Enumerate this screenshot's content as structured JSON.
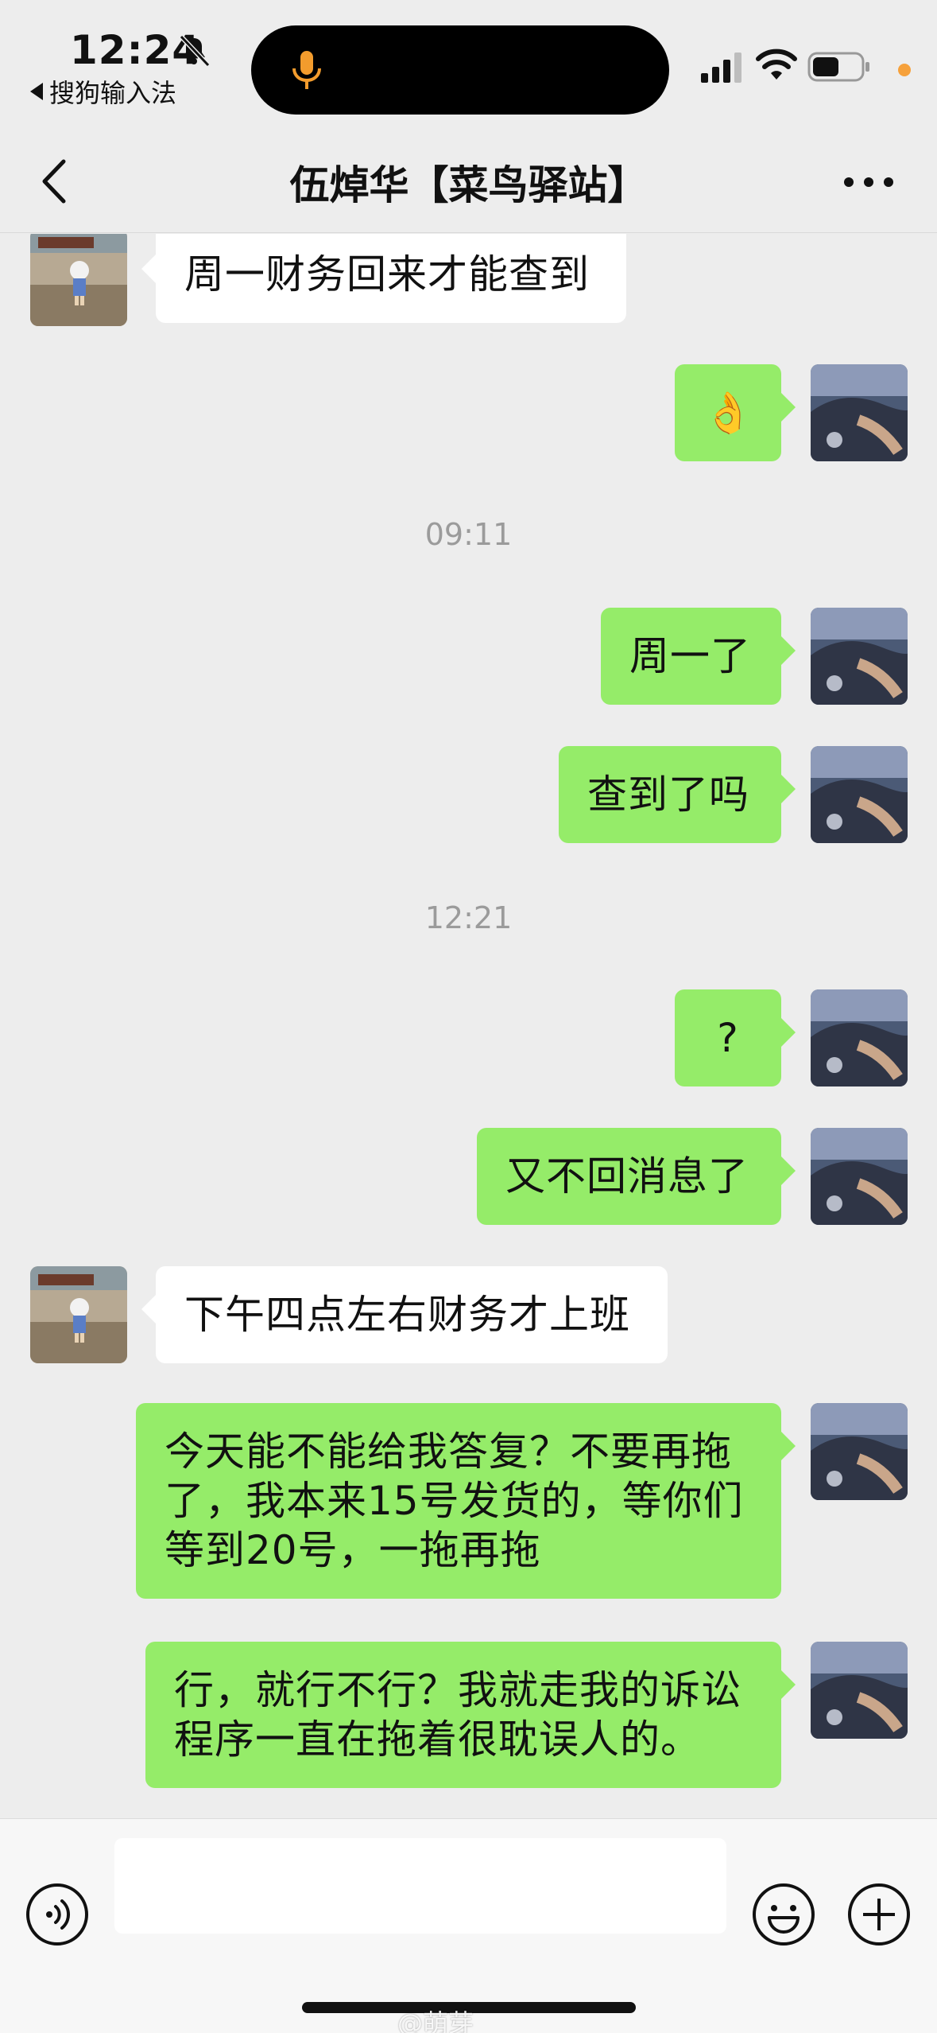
{
  "status_bar": {
    "time": "12:24",
    "back_app": "搜狗输入法"
  },
  "nav": {
    "title": "伍焯华【菜鸟驿站】"
  },
  "messages": [
    {
      "from": "contact",
      "text": "周一财务回来才能查到"
    },
    {
      "from": "me",
      "text": "👌"
    },
    {
      "timestamp": "09:11"
    },
    {
      "from": "me",
      "text": "周一了"
    },
    {
      "from": "me",
      "text": "查到了吗"
    },
    {
      "timestamp": "12:21"
    },
    {
      "from": "me",
      "text": "?"
    },
    {
      "from": "me",
      "text": "又不回消息了"
    },
    {
      "from": "contact",
      "text": "下午四点左右财务才上班"
    },
    {
      "from": "me",
      "text": "今天能不能给我答复？不要再拖了，我本来15号发货的，等你们等到20号，一拖再拖"
    },
    {
      "from": "me",
      "text": "行，就行不行？我就走我的诉讼程序一直在拖着很耽误人的。"
    }
  ],
  "watermark": "@萌芽"
}
